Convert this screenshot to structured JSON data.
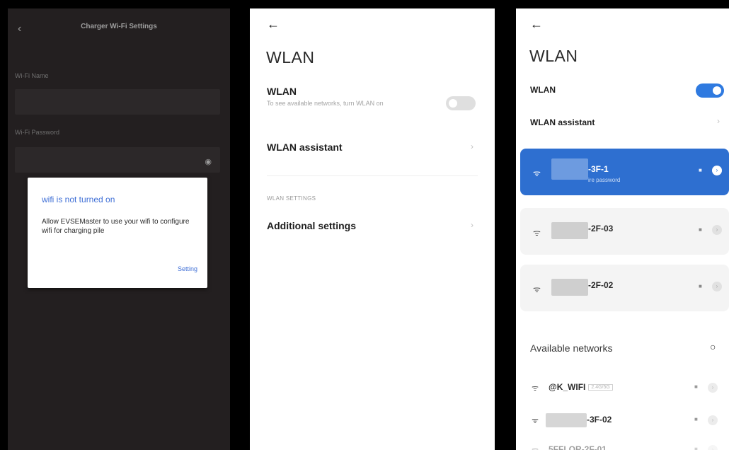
{
  "panel1": {
    "header_title": "Charger Wi-Fi Settings",
    "back_icon": "chevron-left-icon",
    "wifi_name_label": "Wi-Fi Name",
    "wifi_password_label": "Wi-Fi Password",
    "eye_icon": "eye-icon",
    "dialog": {
      "title": "wifi is not turned on",
      "message": "Allow EVSEMaster to use your wifi to configure wifi for charging pile",
      "button": "Setting"
    }
  },
  "panel2": {
    "back_icon": "arrow-left-icon",
    "heading": "WLAN",
    "wlan_label": "WLAN",
    "wlan_subtitle": "To see available networks, turn WLAN on",
    "wlan_toggle_on": false,
    "assistant_label": "WLAN assistant",
    "section_label": "WLAN SETTINGS",
    "additional_label": "Additional settings"
  },
  "panel3": {
    "back_icon": "arrow-left-icon",
    "heading": "WLAN",
    "wlan_label": "WLAN",
    "wlan_toggle_on": true,
    "assistant_label": "WLAN assistant",
    "saved_networks": [
      {
        "ssid": "-3F-1",
        "subtitle": "ire password",
        "active": true
      },
      {
        "ssid": "-2F-03",
        "active": false
      },
      {
        "ssid": "-2F-02",
        "active": false
      }
    ],
    "available_label": "Available networks",
    "refresh_icon": "refresh-icon",
    "available_networks": [
      {
        "ssid": "@K_WIFI",
        "tag": "2.4G/5G"
      },
      {
        "ssid": "-3F-02"
      },
      {
        "ssid": "5FFLOR-2F-01"
      }
    ]
  },
  "colors": {
    "accent_blue": "#2e6fd0",
    "dialog_blue": "#3f6fd6",
    "dark_bg": "#231f20"
  }
}
